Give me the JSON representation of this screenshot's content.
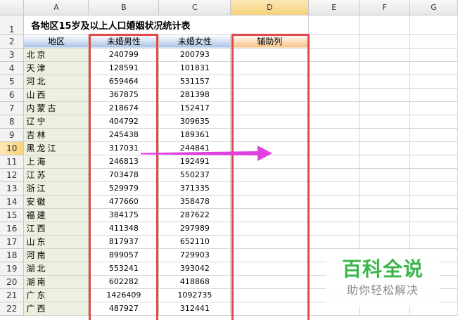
{
  "columns": [
    "A",
    "B",
    "C",
    "D",
    "E",
    "F",
    "G"
  ],
  "row_numbers": [
    1,
    2,
    3,
    4,
    5,
    6,
    7,
    8,
    9,
    10,
    11,
    12,
    13,
    14,
    15,
    16,
    17,
    18,
    19,
    20,
    21,
    22
  ],
  "title": "各地区15岁及以上人口婚姻状况统计表",
  "headers": {
    "region": "地区",
    "male": "未婚男性",
    "female": "未婚女性",
    "helper": "辅助列"
  },
  "rows": [
    {
      "region": "北京",
      "male": "240799",
      "female": "200793"
    },
    {
      "region": "天津",
      "male": "128591",
      "female": "101831"
    },
    {
      "region": "河北",
      "male": "659464",
      "female": "531157"
    },
    {
      "region": "山西",
      "male": "367875",
      "female": "281398"
    },
    {
      "region": "内蒙古",
      "male": "218674",
      "female": "152417"
    },
    {
      "region": "辽宁",
      "male": "404792",
      "female": "309635"
    },
    {
      "region": "吉林",
      "male": "245438",
      "female": "189361"
    },
    {
      "region": "黑龙江",
      "male": "317031",
      "female": "244841"
    },
    {
      "region": "上海",
      "male": "246813",
      "female": "192491"
    },
    {
      "region": "江苏",
      "male": "703478",
      "female": "550237"
    },
    {
      "region": "浙江",
      "male": "529979",
      "female": "371335"
    },
    {
      "region": "安徽",
      "male": "477660",
      "female": "358478"
    },
    {
      "region": "福建",
      "male": "384175",
      "female": "287622"
    },
    {
      "region": "江西",
      "male": "411348",
      "female": "297989"
    },
    {
      "region": "山东",
      "male": "817937",
      "female": "652110"
    },
    {
      "region": "河南",
      "male": "899057",
      "female": "729903"
    },
    {
      "region": "湖北",
      "male": "553241",
      "female": "393042"
    },
    {
      "region": "湖南",
      "male": "602282",
      "female": "418868"
    },
    {
      "region": "广东",
      "male": "1426409",
      "female": "1092735"
    },
    {
      "region": "广西",
      "male": "487927",
      "female": "312441"
    }
  ],
  "annotation": {
    "arrow_color": "#e040e0",
    "box_color": "#e04a4a"
  },
  "watermark": {
    "brand": "百科全说",
    "slogan": "助你轻松解决"
  }
}
